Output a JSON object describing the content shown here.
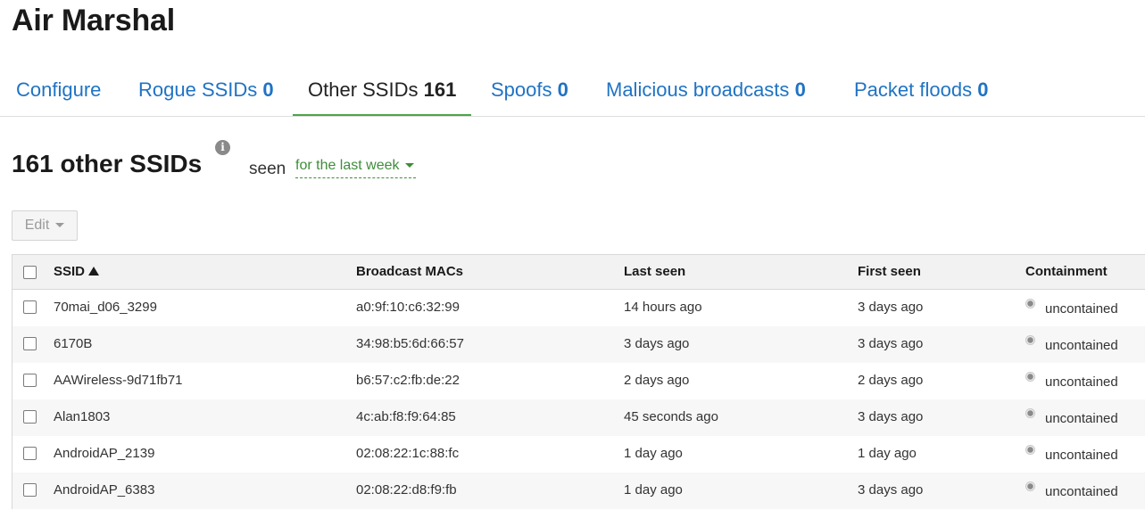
{
  "page": {
    "title": "Air Marshal"
  },
  "tabs": [
    {
      "label": "Configure",
      "count": ""
    },
    {
      "label": "Rogue SSIDs",
      "count": "0"
    },
    {
      "label": "Other SSIDs",
      "count": "161"
    },
    {
      "label": "Spoofs",
      "count": "0"
    },
    {
      "label": "Malicious broadcasts",
      "count": "0"
    },
    {
      "label": "Packet floods",
      "count": "0"
    }
  ],
  "active_tab": "Other SSIDs",
  "section": {
    "title": "161 other SSIDs",
    "info_icon": "info-icon",
    "seen_label": "seen",
    "range": "for the last week"
  },
  "toolbar": {
    "edit_label": "Edit"
  },
  "table": {
    "columns": [
      "SSID",
      "Broadcast MACs",
      "Last seen",
      "First seen",
      "Containment"
    ],
    "sort_column": "SSID",
    "sort_direction": "ascending",
    "rows": [
      [
        "70mai_d06_3299",
        "a0:9f:10:c6:32:99",
        "14 hours ago",
        "3 days ago",
        "uncontained"
      ],
      [
        "6170B",
        "34:98:b5:6d:66:57",
        "3 days ago",
        "3 days ago",
        "uncontained"
      ],
      [
        "AAWireless-9d71fb71",
        "b6:57:c2:fb:de:22",
        "2 days ago",
        "2 days ago",
        "uncontained"
      ],
      [
        "Alan1803",
        "4c:ab:f8:f9:64:85",
        "45 seconds ago",
        "3 days ago",
        "uncontained"
      ],
      [
        "AndroidAP_2139",
        "02:08:22:1c:88:fc",
        "1 day ago",
        "1 day ago",
        "uncontained"
      ],
      [
        "AndroidAP_6383",
        "02:08:22:d8:f9:fb",
        "1 day ago",
        "3 days ago",
        "uncontained"
      ]
    ]
  },
  "colors": {
    "link": "#1f73c4",
    "active_tab_underline": "#4aa548",
    "range_link": "#3f8c3a",
    "title_text": "#1a1a1a"
  }
}
